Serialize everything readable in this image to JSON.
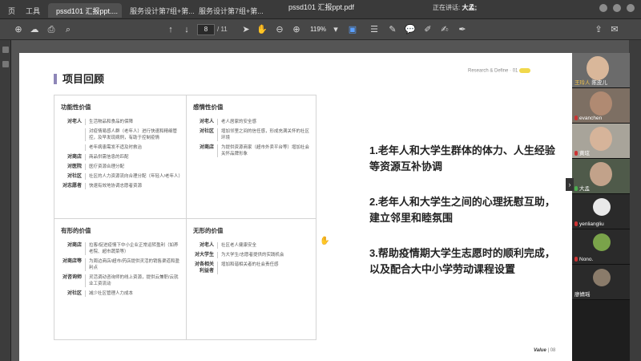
{
  "topbar": {
    "tabs": [
      {
        "label": "页",
        "active": false
      },
      {
        "label": "工具",
        "active": false
      },
      {
        "label": "pssd101 汇报ppt....",
        "active": true
      },
      {
        "label": "服务设计第7组+第...",
        "active": false
      },
      {
        "label": "服务设计第7组+第...",
        "active": false
      }
    ],
    "filename": "pssd101 汇报ppt.pdf",
    "speaking_prefix": "正在讲话:",
    "speaking_name": "大孟;"
  },
  "toolbar": {
    "page_current": "8",
    "page_total": "/ 11",
    "zoom": "119%"
  },
  "slide": {
    "title": "项目回顾",
    "header_right": "Research & Define · 01",
    "quadrants": [
      {
        "title": "功能性价值",
        "rows": [
          {
            "label": "对老人",
            "text": "生活物品和食品的保障"
          },
          {
            "label": "",
            "text": "对疫情易感人群（老年人）进行快速和精细管控，及早发现病例，有助于控制疫情"
          },
          {
            "label": "",
            "text": "老年病患需发不适及时救治"
          },
          {
            "label": "对商店",
            "text": "商品供需信息的匹配"
          },
          {
            "label": "对医院",
            "text": "医疗资源合理分配"
          },
          {
            "label": "对社区",
            "text": "社区的人力资源流向合理分配（年轻人/老年人）"
          },
          {
            "label": "对志愿者",
            "text": "快速有效地协调志愿者资源"
          }
        ]
      },
      {
        "title": "感情性价值",
        "rows": [
          {
            "label": "对老人",
            "text": "老人居家的安全感"
          },
          {
            "label": "对社区",
            "text": "增加邻里之间的信任感，形成充满关怀的社区环境"
          },
          {
            "label": "对商店",
            "text": "为提供资源商家（超市外卖平台等）增加社会关怀品牌形象"
          }
        ]
      },
      {
        "title": "有形的价值",
        "rows": [
          {
            "label": "对商店",
            "text": "拉客/促进疫情下中小企业正常运转盈利（如养老院、超市蔬菜等）"
          },
          {
            "label": "对商店等",
            "text": "为周边商店/超市/药店提供灵活的销售渠道和盈利点"
          },
          {
            "label": "对咨询师",
            "text": "灵活调动咨询师的线上资源，提供云兼职/云就业工资流动"
          },
          {
            "label": "对社区",
            "text": "减少社区管理人力成本"
          }
        ]
      },
      {
        "title": "无形的价值",
        "rows": [
          {
            "label": "对老人",
            "text": "社区老人健康安全"
          },
          {
            "label": "对大学生",
            "text": "为大学生/志愿者提供的实践机会"
          },
          {
            "label": "对各相关利益者",
            "text": "增加和谐相关者的社会责任感"
          }
        ]
      }
    ],
    "points": [
      "1.老年人和大学生群体的体力、人生经验等资源互补协调",
      "2.老年人和大学生之间的心理抚慰互助，建立邻里和睦氛围",
      "3.帮助疫情期大学生志愿时的顺利完成，以及配合大中小学劳动课程设置"
    ],
    "footer_label": "Value",
    "footer_page": "| 08"
  },
  "participants": [
    {
      "name": "王玲人",
      "name2": "陈皮儿"
    },
    {
      "name": "evanchen"
    },
    {
      "name": "黄玹"
    },
    {
      "name": "大孟"
    },
    {
      "name": "yenliangliu"
    },
    {
      "name": "Nono."
    },
    {
      "name": "廖婧瑶"
    }
  ]
}
